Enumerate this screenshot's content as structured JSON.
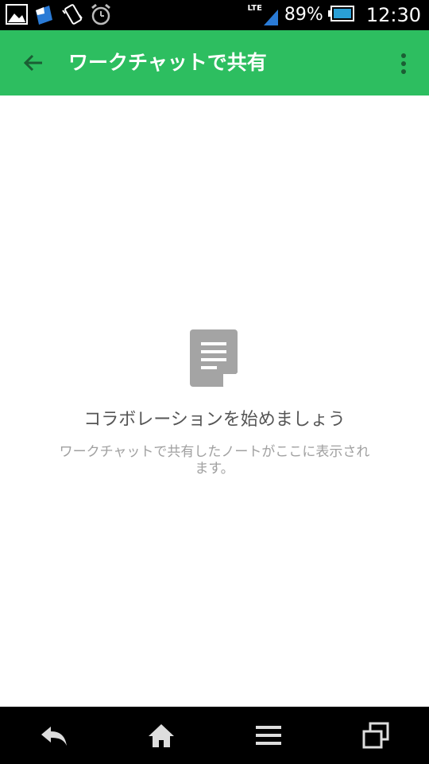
{
  "status_bar": {
    "network": "LTE",
    "battery": "89%",
    "time": "12:30",
    "icons": [
      "gallery-icon",
      "evernote-icon",
      "vibrate-icon",
      "alarm-icon",
      "signal-icon",
      "battery-icon"
    ]
  },
  "app_bar": {
    "title": "ワークチャットで共有",
    "accent_color": "#2dbe60"
  },
  "empty_state": {
    "title": "コラボレーションを始めましょう",
    "description": "ワークチャットで共有したノートがここに表示されます。"
  },
  "nav_bar": {
    "buttons": [
      "back-icon",
      "home-icon",
      "menu-icon",
      "recent-apps-icon"
    ]
  }
}
